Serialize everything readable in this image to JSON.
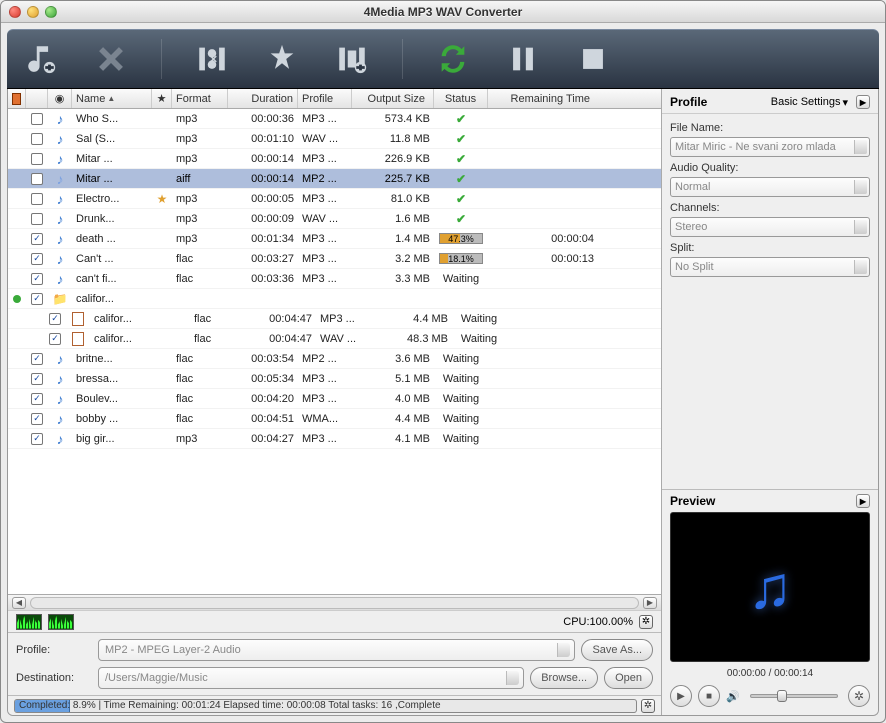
{
  "window": {
    "title": "4Media MP3 WAV Converter"
  },
  "columns": {
    "name": "Name",
    "star": "★",
    "format": "Format",
    "duration": "Duration",
    "profile": "Profile",
    "output_size": "Output Size",
    "status": "Status",
    "remaining": "Remaining Time"
  },
  "rows": [
    {
      "chk": false,
      "name": "Who S...",
      "fmt": "mp3",
      "dur": "00:00:36",
      "prof": "MP3 ...",
      "size": "573.4 KB",
      "status": "ok"
    },
    {
      "chk": false,
      "name": "Sal  (S...",
      "fmt": "mp3",
      "dur": "00:01:10",
      "prof": "WAV ...",
      "size": "11.8 MB",
      "status": "ok"
    },
    {
      "chk": false,
      "name": "Mitar ...",
      "fmt": "mp3",
      "dur": "00:00:14",
      "prof": "MP3 ...",
      "size": "226.9 KB",
      "status": "ok"
    },
    {
      "chk": false,
      "sel": true,
      "name": "Mitar ...",
      "fmt": "aiff",
      "dur": "00:00:14",
      "prof": "MP2 ...",
      "size": "225.7 KB",
      "status": "ok"
    },
    {
      "chk": false,
      "star": true,
      "name": "Electro...",
      "fmt": "mp3",
      "dur": "00:00:05",
      "prof": "MP3 ...",
      "size": "81.0 KB",
      "status": "ok"
    },
    {
      "chk": false,
      "name": "Drunk...",
      "fmt": "mp3",
      "dur": "00:00:09",
      "prof": "WAV ...",
      "size": "1.6 MB",
      "status": "ok"
    },
    {
      "chk": true,
      "name": "death ...",
      "fmt": "mp3",
      "dur": "00:01:34",
      "prof": "MP3 ...",
      "size": "1.4 MB",
      "status": "prog",
      "pct": "47.3%",
      "pw": 47,
      "rem": "00:00:04"
    },
    {
      "chk": true,
      "name": "Can't ...",
      "fmt": "flac",
      "dur": "00:03:27",
      "prof": "MP3 ...",
      "size": "3.2 MB",
      "status": "prog",
      "pct": "18.1%",
      "pw": 18,
      "rem": "00:00:13"
    },
    {
      "chk": true,
      "name": "can't fi...",
      "fmt": "flac",
      "dur": "00:03:36",
      "prof": "MP3 ...",
      "size": "3.3 MB",
      "status": "Waiting"
    },
    {
      "folder": true,
      "chk": true,
      "play": true,
      "name": "califor..."
    },
    {
      "indent": true,
      "chk": true,
      "doc": true,
      "name": "califor...",
      "fmt": "flac",
      "dur": "00:04:47",
      "prof": "MP3 ...",
      "size": "4.4 MB",
      "status": "Waiting"
    },
    {
      "indent": true,
      "chk": true,
      "doc": true,
      "name": "califor...",
      "fmt": "flac",
      "dur": "00:04:47",
      "prof": "WAV ...",
      "size": "48.3 MB",
      "status": "Waiting"
    },
    {
      "chk": true,
      "name": "britne...",
      "fmt": "flac",
      "dur": "00:03:54",
      "prof": "MP2 ...",
      "size": "3.6 MB",
      "status": "Waiting"
    },
    {
      "chk": true,
      "name": "bressa...",
      "fmt": "flac",
      "dur": "00:05:34",
      "prof": "MP3 ...",
      "size": "5.1 MB",
      "status": "Waiting"
    },
    {
      "chk": true,
      "name": "Boulev...",
      "fmt": "flac",
      "dur": "00:04:20",
      "prof": "MP3 ...",
      "size": "4.0 MB",
      "status": "Waiting"
    },
    {
      "chk": true,
      "name": "bobby ...",
      "fmt": "flac",
      "dur": "00:04:51",
      "prof": "WMA...",
      "size": "4.4 MB",
      "status": "Waiting"
    },
    {
      "chk": true,
      "name": "big gir...",
      "fmt": "mp3",
      "dur": "00:04:27",
      "prof": "MP3 ...",
      "size": "4.1 MB",
      "status": "Waiting"
    }
  ],
  "cpu": {
    "label": "CPU:100.00%"
  },
  "form": {
    "profile_label": "Profile:",
    "profile_value": "MP2 - MPEG Layer-2 Audio",
    "saveas": "Save As...",
    "destination_label": "Destination:",
    "destination_value": "/Users/Maggie/Music",
    "browse": "Browse...",
    "open": "Open"
  },
  "statusbar": {
    "text": "Completed: 8.9% | Time Remaining: 00:01:24 Elapsed time: 00:00:08 Total tasks: 16 ,Complete",
    "pct": 8.9
  },
  "sidebar": {
    "heading": "Profile",
    "settings": "Basic Settings",
    "file_name_label": "File Name:",
    "file_name_value": "Mitar Miric - Ne svani zoro mlada",
    "audio_quality_label": "Audio Quality:",
    "audio_quality_value": "Normal",
    "channels_label": "Channels:",
    "channels_value": "Stereo",
    "split_label": "Split:",
    "split_value": "No Split"
  },
  "preview": {
    "title": "Preview",
    "time": "00:00:00 / 00:00:14"
  }
}
